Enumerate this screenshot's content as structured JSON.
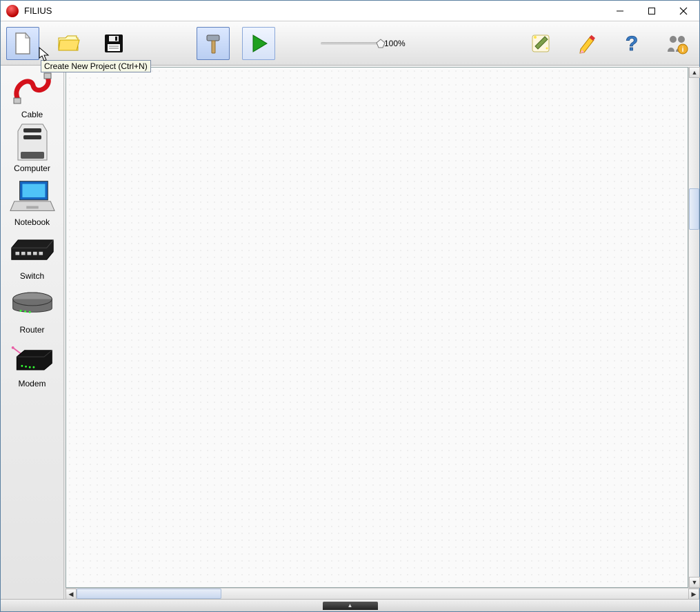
{
  "titlebar": {
    "app_title": "FILIUS"
  },
  "toolbar": {
    "new_tooltip": "Create New Project (Ctrl+N)",
    "zoom_label": "100%"
  },
  "palette": {
    "items": [
      {
        "label": "Cable"
      },
      {
        "label": "Computer"
      },
      {
        "label": "Notebook"
      },
      {
        "label": "Switch"
      },
      {
        "label": "Router"
      },
      {
        "label": "Modem"
      }
    ]
  }
}
